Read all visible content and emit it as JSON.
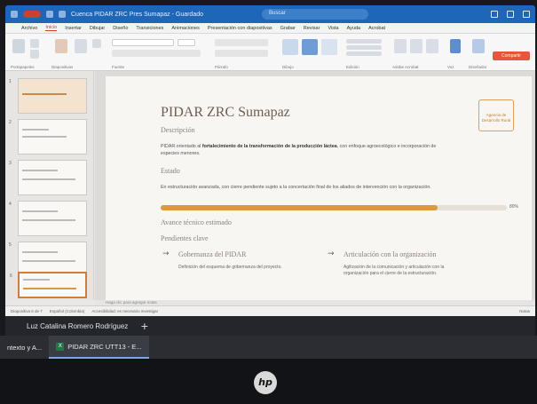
{
  "window": {
    "title": "Cuenca PIDAR ZRC Pres Sumapaz - Guardado",
    "search_placeholder": "Buscar"
  },
  "menu": [
    "Archivo",
    "Inicio",
    "Insertar",
    "Dibujar",
    "Diseño",
    "Transiciones",
    "Animaciones",
    "Presentación con diapositivas",
    "Grabar",
    "Revisar",
    "Vista",
    "Ayuda",
    "Acrobat"
  ],
  "menu_active_index": 1,
  "ribbon": {
    "groups": [
      "Portapapeles",
      "Diapositivas",
      "Fuente",
      "Párrafo",
      "Dibujo",
      "Edición",
      "Adobe Acrobat",
      "Voz",
      "Diseñador"
    ],
    "share_label": "Compartir"
  },
  "slide": {
    "title": "PIDAR ZRC Sumapaz",
    "logo_text": "Agencia de Desarrollo Rural",
    "descripcion_heading": "Descripción",
    "descripcion_pre": "PIDAR orientado al ",
    "descripcion_bold": "fortalecimiento de la transformación de la producción láctea",
    "descripcion_post": ", con enfoque agroecológico e incorporación de",
    "descripcion_line2": "especies menores.",
    "estado_heading": "Estado",
    "estado_text": "En estructuración avanzada, con cierre pendiente sujeto a la concertación final de los aliados de intervención con la organización.",
    "progress_percent": 80,
    "progress_label": "80%",
    "avance_heading": "Avance técnico estimado",
    "pendientes_heading": "Pendientes clave",
    "pendientes": [
      {
        "title": "Gobernanza del PIDAR",
        "desc": "Definición del esquema de gobernanza del proyecto."
      },
      {
        "title": "Articulación con la organización",
        "desc_line1": "Agilización de la comunicación y articulación con la",
        "desc_line2": "organización para el cierre de la estructuración."
      }
    ]
  },
  "notes_placeholder": "Haga clic para agregar notas",
  "statusbar": {
    "left": "Diapositiva 6 de 7",
    "lang": "Español (Colombia)",
    "access": "Accesibilidad: es necesario investigar",
    "zoom": "Notas"
  },
  "user": {
    "name": "Luz Catalina Romero Rodríguez"
  },
  "taskbar": {
    "items": [
      {
        "label": "ntexto y A..."
      },
      {
        "label": "PIDAR ZRC UTT13 - E..."
      }
    ]
  },
  "brand": {
    "logo": "hp"
  },
  "colors": {
    "accent": "#d99a3e",
    "title": "#6e5d53",
    "office_blue": "#1e66b8",
    "share": "#e5563a"
  }
}
